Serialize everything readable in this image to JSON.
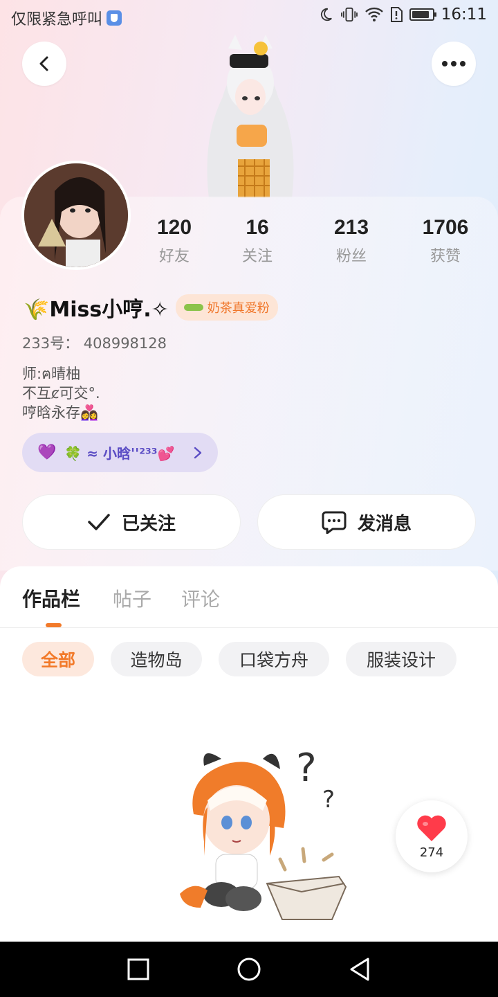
{
  "status_bar": {
    "left_text": "仅限紧急呼叫",
    "time": "16:11",
    "icons": [
      "shield-icon",
      "moon-icon",
      "vibrate-icon",
      "wifi-icon",
      "sim-alert-icon",
      "battery-icon"
    ],
    "battery_level": 0.85
  },
  "header": {
    "back_icon": "chevron-left-icon",
    "more_icon": "more-dots-icon"
  },
  "stats": [
    {
      "value": "120",
      "label": "好友"
    },
    {
      "value": "16",
      "label": "关注"
    },
    {
      "value": "213",
      "label": "粉丝"
    },
    {
      "value": "1706",
      "label": "获赞"
    }
  ],
  "profile": {
    "name": "🌾Miss小哼.✧",
    "badge": "奶茶真爱粉",
    "uid": "233号：  408998128",
    "bio_lines": [
      "师:ฅ晴柚",
      "不互ȼ可交°.",
      "哼晗永存👩‍❤️‍👩"
    ]
  },
  "group_pill": {
    "text": "🍀 ≈ 小晗''²³³💕"
  },
  "actions": {
    "follow_label": "已关注",
    "message_label": "发消息"
  },
  "tabs": [
    {
      "label": "作品栏",
      "active": true
    },
    {
      "label": "帖子",
      "active": false
    },
    {
      "label": "评论",
      "active": false
    }
  ],
  "chips": [
    {
      "label": "全部",
      "active": true
    },
    {
      "label": "造物岛",
      "active": false
    },
    {
      "label": "口袋方舟",
      "active": false
    },
    {
      "label": "服装设计",
      "active": false
    }
  ],
  "like_float": {
    "count": "274"
  },
  "colors": {
    "accent": "#f27a2a",
    "pill_purple": "#5a4cc4",
    "heart_red": "#ff3b4a"
  }
}
